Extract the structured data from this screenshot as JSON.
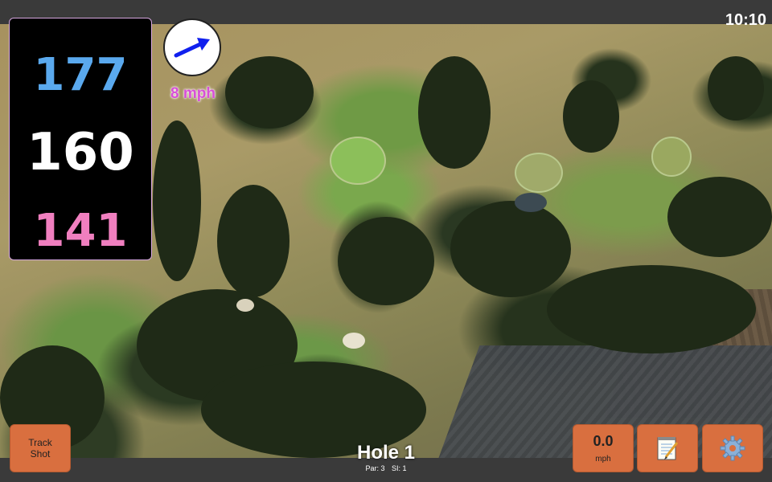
{
  "clock": "10:10",
  "distances": {
    "back": "177",
    "middle": "160",
    "front": "141"
  },
  "wind": {
    "speed": "8 mph",
    "direction_icon": "arrow-right-icon"
  },
  "hole": {
    "title": "Hole 1",
    "par": "Par: 3",
    "si": "SI: 1"
  },
  "controls": {
    "track_shot_line1": "Track",
    "track_shot_line2": "Shot",
    "speed_value": "0.0",
    "speed_unit": "mph",
    "notes_icon": "notepad-icon",
    "settings_icon": "gear-icon"
  },
  "colors": {
    "back": "#5aa9ee",
    "middle": "#ffffff",
    "front": "#f07fbf",
    "button": "#d96f3f",
    "wind_text": "#d84fd8"
  }
}
